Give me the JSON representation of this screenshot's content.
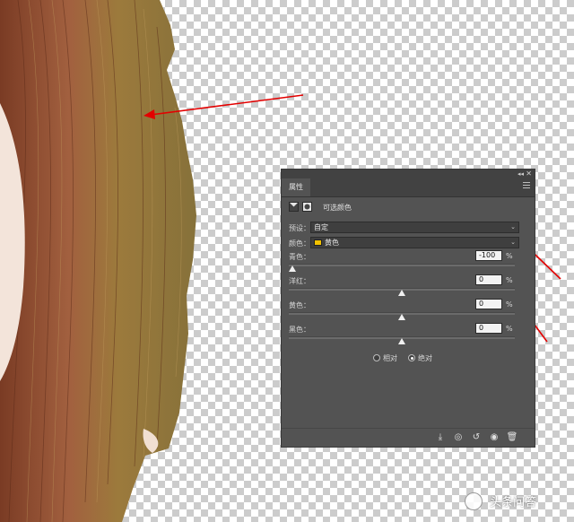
{
  "panel": {
    "tab_label": "属性",
    "adjustment_title": "可选颜色",
    "preset": {
      "label": "预设：",
      "value": "自定"
    },
    "colors": {
      "label": "颜色：",
      "value": "黄色",
      "swatch_color": "#f2c200"
    },
    "sliders": [
      {
        "label": "青色：",
        "value": "-100",
        "unit": "%",
        "level": -100
      },
      {
        "label": "洋红：",
        "value": "0",
        "unit": "%",
        "level": 0
      },
      {
        "label": "黄色：",
        "value": "0",
        "unit": "%",
        "level": 0
      },
      {
        "label": "黑色：",
        "value": "0",
        "unit": "%",
        "level": 0
      }
    ],
    "method": {
      "relative_label": "相对",
      "absolute_label": "绝对",
      "selected": "absolute"
    }
  },
  "watermark": {
    "text": "头条问答"
  },
  "colors": {
    "panel_bg": "#535353",
    "annotation_arrow": "#e30000",
    "hair": "#9a5a3a"
  }
}
